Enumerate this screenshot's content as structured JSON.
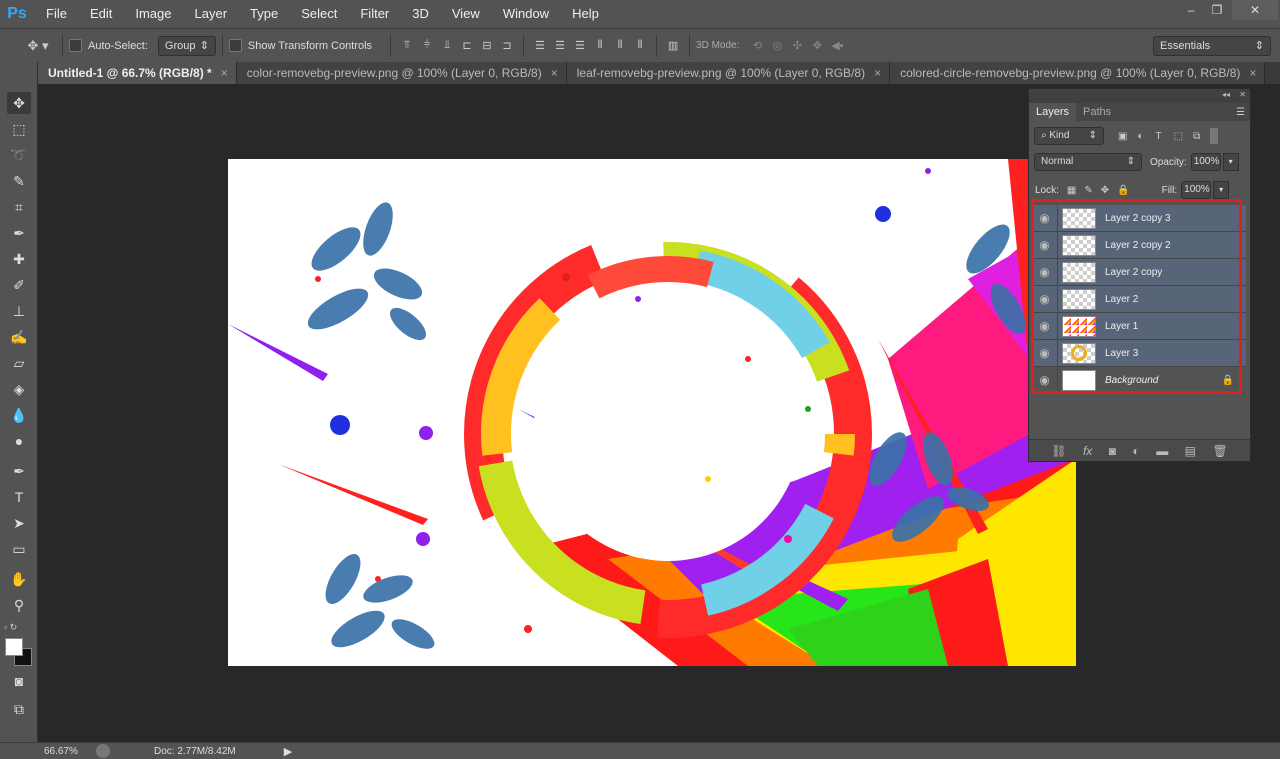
{
  "app": {
    "logo": "Ps"
  },
  "menu": [
    "File",
    "Edit",
    "Image",
    "Layer",
    "Type",
    "Select",
    "Filter",
    "3D",
    "View",
    "Window",
    "Help"
  ],
  "options": {
    "auto_select_label": "Auto-Select:",
    "auto_select_value": "Group",
    "transform_label": "Show Transform Controls",
    "mode3d_label": "3D Mode:",
    "workspace": "Essentials"
  },
  "tabs": [
    {
      "label": "Untitled-1 @ 66.7% (RGB/8) *",
      "active": true
    },
    {
      "label": "color-removebg-preview.png @ 100% (Layer 0, RGB/8)",
      "active": false
    },
    {
      "label": "leaf-removebg-preview.png @ 100% (Layer 0, RGB/8)",
      "active": false
    },
    {
      "label": "colored-circle-removebg-preview.png @ 100% (Layer 0, RGB/8)",
      "active": false
    }
  ],
  "tab_close": "×",
  "layers_panel": {
    "tabs": [
      "Layers",
      "Paths"
    ],
    "filter": "Kind",
    "blend_mode": "Normal",
    "opacity_label": "Opacity:",
    "opacity_value": "100%",
    "lock_label": "Lock:",
    "fill_label": "Fill:",
    "fill_value": "100%",
    "layers": [
      {
        "name": "Layer 2 copy 3",
        "selected": true
      },
      {
        "name": "Layer 2 copy 2",
        "selected": true
      },
      {
        "name": "Layer 2 copy",
        "selected": true
      },
      {
        "name": "Layer 2",
        "selected": true
      },
      {
        "name": "Layer 1",
        "selected": true
      },
      {
        "name": "Layer 3",
        "selected": true
      },
      {
        "name": "Background",
        "selected": false
      }
    ],
    "highlight_color": "#e02020"
  },
  "status": {
    "zoom": "66.67%",
    "doc": "Doc: 2.77M/8.42M"
  }
}
